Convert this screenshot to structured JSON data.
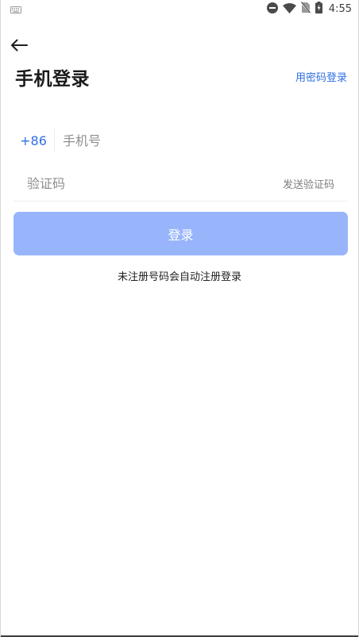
{
  "status_bar": {
    "time": "4:55",
    "icons": [
      "keyboard-icon",
      "dnd-icon",
      "wifi-icon",
      "no-sim-icon",
      "battery-charging-icon"
    ]
  },
  "header": {
    "title": "手机登录",
    "password_login_link": "用密码登录"
  },
  "phone_field": {
    "country_code": "+86",
    "placeholder": "手机号",
    "value": ""
  },
  "code_field": {
    "placeholder": "验证码",
    "value": "",
    "send_code_label": "发送验证码"
  },
  "login_button": {
    "label": "登录",
    "color": "#98b5fb"
  },
  "notice": "未注册号码会自动注册登录",
  "accent_color": "#2f6fe6"
}
